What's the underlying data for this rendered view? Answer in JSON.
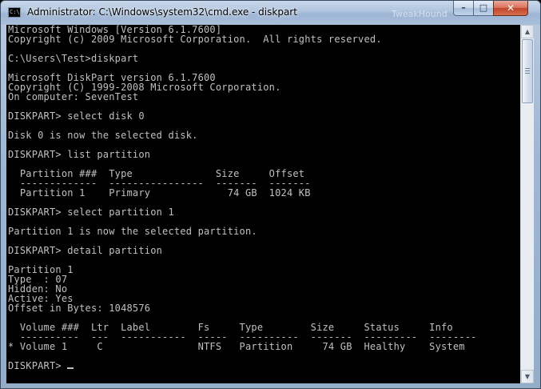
{
  "window": {
    "title": "Administrator: C:\\Windows\\system32\\cmd.exe - diskpart",
    "watermark": "TweakHound",
    "icon_text": "C:\\",
    "controls": {
      "minimize": "–",
      "maximize": "□",
      "close": "✕"
    }
  },
  "console": {
    "lines": [
      "Microsoft Windows [Version 6.1.7600]",
      "Copyright (c) 2009 Microsoft Corporation.  All rights reserved.",
      "",
      "C:\\Users\\Test>diskpart",
      "",
      "Microsoft DiskPart version 6.1.7600",
      "Copyright (C) 1999-2008 Microsoft Corporation.",
      "On computer: SevenTest",
      "",
      "DISKPART> select disk 0",
      "",
      "Disk 0 is now the selected disk.",
      "",
      "DISKPART> list partition",
      "",
      "  Partition ###  Type              Size     Offset",
      "  -------------  ----------------  -------  -------",
      "  Partition 1    Primary             74 GB  1024 KB",
      "",
      "DISKPART> select partition 1",
      "",
      "Partition 1 is now the selected partition.",
      "",
      "DISKPART> detail partition",
      "",
      "Partition 1",
      "Type  : 07",
      "Hidden: No",
      "Active: Yes",
      "Offset in Bytes: 1048576",
      "",
      "  Volume ###  Ltr  Label        Fs     Type        Size     Status     Info",
      "  ----------  ---  -----------  -----  ----------  -------  ---------  --------",
      "* Volume 1     C                NTFS   Partition     74 GB  Healthy    System",
      "",
      "DISKPART> "
    ]
  },
  "scrollbar": {
    "up_arrow": "▲",
    "down_arrow": "▼"
  }
}
